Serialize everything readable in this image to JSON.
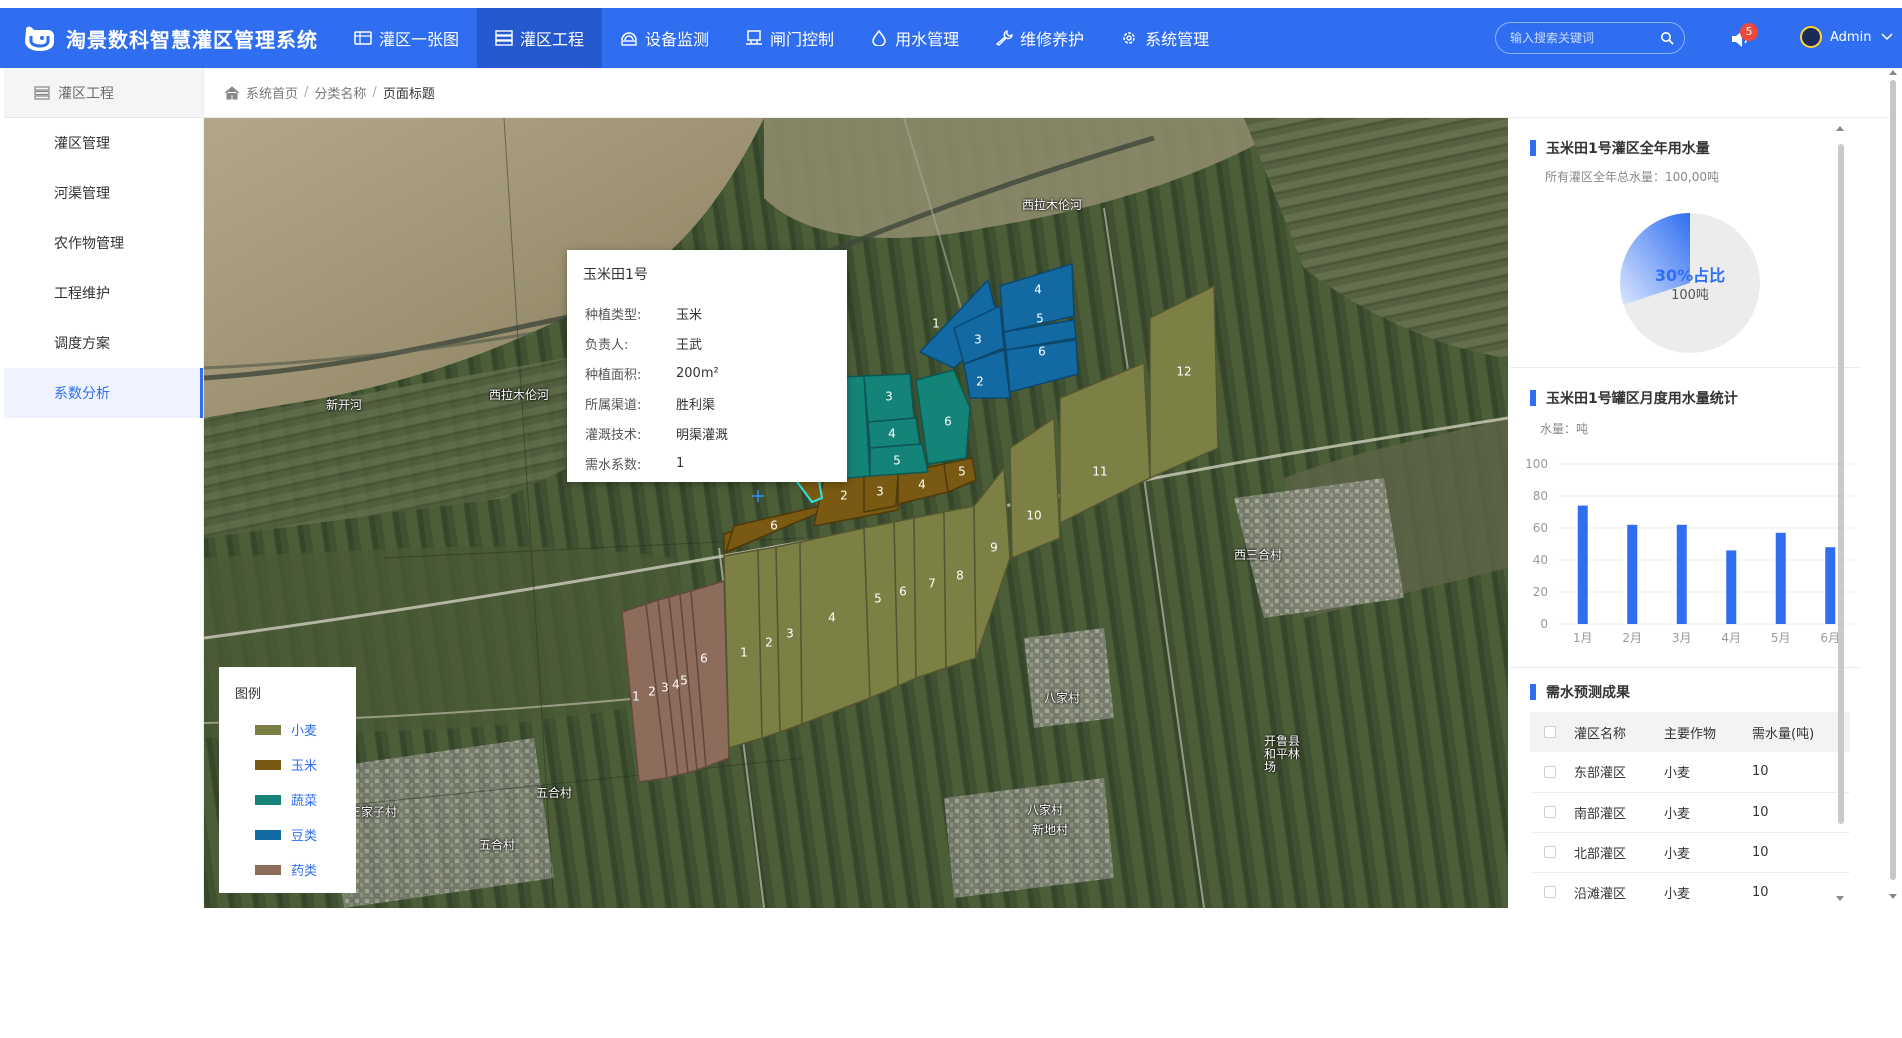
{
  "app": {
    "title": "淘景数科智慧灌区管理系统"
  },
  "nav": [
    {
      "label": "灌区一张图",
      "icon": "map-icon"
    },
    {
      "label": "灌区工程",
      "icon": "list-icon"
    },
    {
      "label": "设备监测",
      "icon": "monitor-icon"
    },
    {
      "label": "闸门控制",
      "icon": "gate-icon"
    },
    {
      "label": "用水管理",
      "icon": "water-drop-icon"
    },
    {
      "label": "维修养护",
      "icon": "wrench-icon"
    },
    {
      "label": "系统管理",
      "icon": "gear-icon"
    }
  ],
  "search": {
    "placeholder": "输入搜索关键词"
  },
  "notifications": {
    "count": "5"
  },
  "user": {
    "name": "Admin"
  },
  "sidebar": {
    "header": "灌区工程",
    "items": [
      {
        "label": "灌区管理"
      },
      {
        "label": "河渠管理"
      },
      {
        "label": "农作物管理"
      },
      {
        "label": "工程维护"
      },
      {
        "label": "调度方案"
      },
      {
        "label": "系数分析"
      }
    ]
  },
  "breadcrumb": {
    "home": "系统首页",
    "category": "分类名称",
    "current": "页面标题"
  },
  "map": {
    "place_labels": [
      "西拉木伦河",
      "西拉木伦河",
      "新开河",
      "西三合村",
      "八家村",
      "开鲁县和平林场",
      "五合村",
      "五合村",
      "八家村",
      "新地村",
      "三家子村"
    ],
    "popup": {
      "title": "玉米田1号",
      "rows": [
        {
          "k": "种植类型:",
          "v": "玉米"
        },
        {
          "k": "负责人:",
          "v": "王武"
        },
        {
          "k": "种植面积:",
          "v": "200m²"
        },
        {
          "k": "所属渠道:",
          "v": "胜利渠"
        },
        {
          "k": "灌溉技术:",
          "v": "明渠灌溉"
        },
        {
          "k": "需水系数:",
          "v": "1"
        }
      ]
    },
    "legend": {
      "title": "图例",
      "items": [
        {
          "label": "小麦",
          "color": "#7d8044"
        },
        {
          "label": "玉米",
          "color": "#7a5a12"
        },
        {
          "label": "蔬菜",
          "color": "#148479"
        },
        {
          "label": "豆类",
          "color": "#136aa3"
        },
        {
          "label": "药类",
          "color": "#8e6c5c"
        }
      ]
    },
    "colors": {
      "wheat": "#7d8044",
      "corn": "#7a5a12",
      "veg": "#148479",
      "bean": "#136aa3",
      "herb": "#8e6c5c",
      "selected": "#2ee6e6"
    }
  },
  "annual": {
    "title": "玉米田1号灌区全年用水量",
    "subtitle": "所有灌区全年总水量：100,00吨",
    "percent_label": "30%占比",
    "amount_label": "100吨",
    "share": 0.3,
    "colors": {
      "fill": "#2f6ef0",
      "rest": "#ececec"
    }
  },
  "monthly": {
    "title": "玉米田1号罐区月度用水量统计",
    "unit": "水量：吨",
    "chart_data": {
      "type": "bar",
      "categories": [
        "1月",
        "2月",
        "3月",
        "4月",
        "5月",
        "6月"
      ],
      "values": [
        74,
        62,
        62,
        46,
        57,
        48
      ],
      "ylim": [
        0,
        100
      ],
      "yticks": [
        "100",
        "80",
        "60",
        "40",
        "20",
        "0"
      ],
      "color": "#2f6ef0"
    }
  },
  "prediction": {
    "title": "需水预测成果",
    "columns": [
      "灌区名称",
      "主要作物",
      "需水量(吨)"
    ],
    "rows": [
      [
        "东部灌区",
        "小麦",
        "10"
      ],
      [
        "南部灌区",
        "小麦",
        "10"
      ],
      [
        "北部灌区",
        "小麦",
        "10"
      ],
      [
        "沿滩灌区",
        "小麦",
        "10"
      ]
    ]
  }
}
